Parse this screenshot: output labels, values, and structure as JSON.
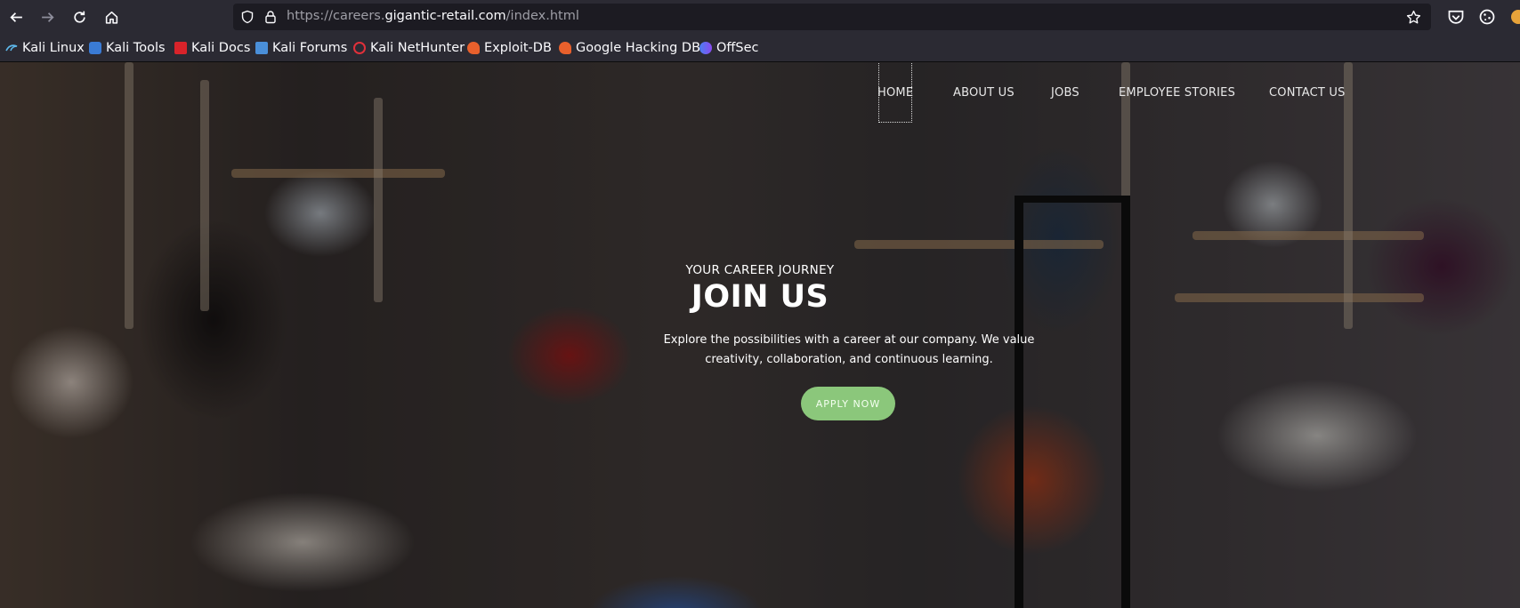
{
  "browser": {
    "url_prefix": "https://careers.",
    "url_domain": "gigantic-retail.com",
    "url_path": "/index.html",
    "icons": {
      "back": "arrow-left-icon",
      "forward": "arrow-right-icon",
      "reload": "reload-icon",
      "home": "home-icon",
      "tracking": "shield-icon",
      "lock": "lock-icon",
      "bookmark": "star-icon",
      "pocket": "pocket-icon",
      "extension": "cookie-icon"
    }
  },
  "bookmarks": [
    {
      "label": "Kali Linux",
      "icon": "kali-dragon-icon"
    },
    {
      "label": "Kali Tools",
      "icon": "kali-tools-icon"
    },
    {
      "label": "Kali Docs",
      "icon": "kali-docs-icon"
    },
    {
      "label": "Kali Forums",
      "icon": "kali-forums-icon"
    },
    {
      "label": "Kali NetHunter",
      "icon": "nethunter-icon"
    },
    {
      "label": "Exploit-DB",
      "icon": "exploit-db-icon"
    },
    {
      "label": "Google Hacking DB",
      "icon": "ghdb-icon"
    },
    {
      "label": "OffSec",
      "icon": "offsec-icon"
    }
  ],
  "nav": {
    "items": [
      "HOME",
      "ABOUT US",
      "JOBS",
      "EMPLOYEE STORIES",
      "CONTACT US"
    ]
  },
  "hero": {
    "eyebrow": "YOUR CAREER JOURNEY",
    "headline": "JOIN US",
    "lead": "Explore the possibilities with a career at our company. We value creativity, collaboration, and continuous learning.",
    "cta": "APPLY NOW"
  },
  "colors": {
    "chrome_bg": "#2b2a33",
    "urlbar_bg": "#1c1b22",
    "cta_bg": "#8bc77b"
  }
}
